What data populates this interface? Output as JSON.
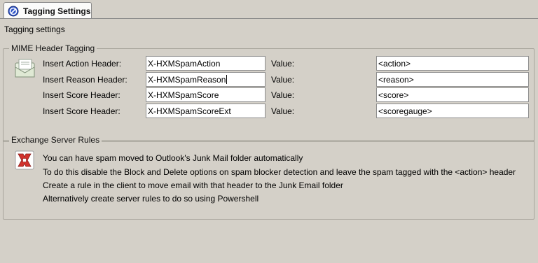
{
  "tab": {
    "label": "Tagging Settings"
  },
  "page": {
    "title": "Tagging settings"
  },
  "mime": {
    "legend": "MIME Header Tagging",
    "value_label": "Value:",
    "rows": [
      {
        "label": "Insert Action Header:",
        "header": "X-HXMSpamAction",
        "value": "<action>"
      },
      {
        "label": "Insert Reason Header:",
        "header": "X-HXMSpamReason",
        "value": "<reason>"
      },
      {
        "label": "Insert Score Header:",
        "header": "X-HXMSpamScore",
        "value": "<score>"
      },
      {
        "label": "Insert Score Header:",
        "header": "X-HXMSpamScoreExt",
        "value": "<scoregauge>"
      }
    ]
  },
  "rules": {
    "legend": "Exchange Server Rules",
    "lines": [
      "You can have spam moved to Outlook's Junk Mail folder automatically",
      "To do this disable the Block and Delete options on spam blocker detection and leave the spam tagged with the <action> header",
      "Create a rule in the client to move email with that header to the Junk Email folder",
      "Alternatively create server rules to do so using Powershell"
    ]
  }
}
